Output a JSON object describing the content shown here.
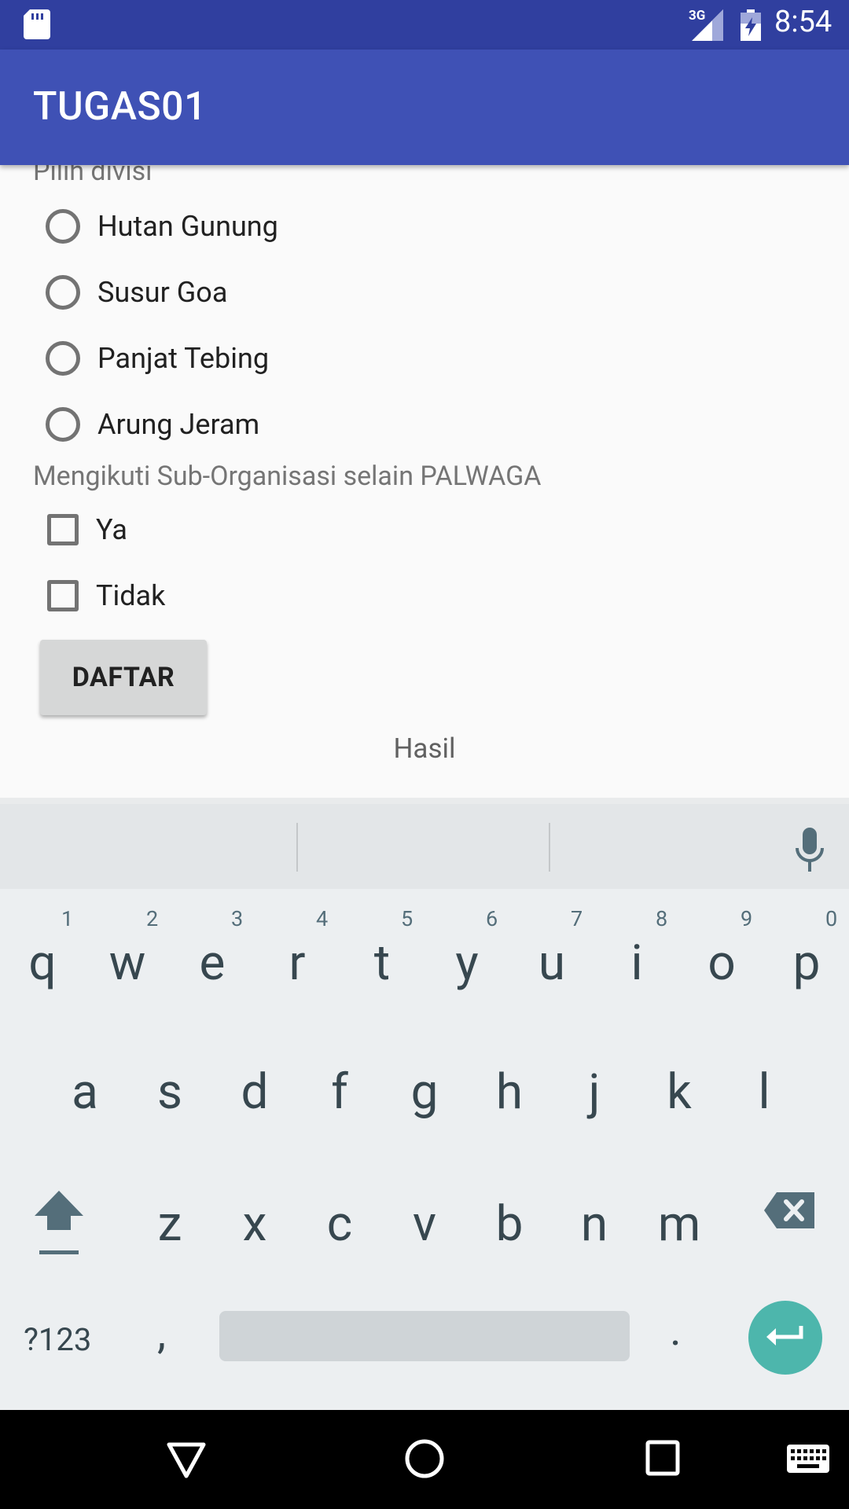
{
  "status_bar": {
    "time": "8:54",
    "network": "3G"
  },
  "app_bar": {
    "title": "TUGAS01"
  },
  "form": {
    "division_label": "Pilih divisi",
    "divisions": [
      "Hutan Gunung",
      "Susur Goa",
      "Panjat Tebing",
      "Arung Jeram"
    ],
    "sub_org_label": "Mengikuti Sub-Organisasi selain PALWAGA",
    "sub_org_options": [
      "Ya",
      "Tidak"
    ],
    "submit_label": "DAFTAR",
    "result_text": "Hasil"
  },
  "keyboard": {
    "row1": [
      "q",
      "w",
      "e",
      "r",
      "t",
      "y",
      "u",
      "i",
      "o",
      "p"
    ],
    "row1_hints": [
      "1",
      "2",
      "3",
      "4",
      "5",
      "6",
      "7",
      "8",
      "9",
      "0"
    ],
    "row2": [
      "a",
      "s",
      "d",
      "f",
      "g",
      "h",
      "j",
      "k",
      "l"
    ],
    "row3": [
      "z",
      "x",
      "c",
      "v",
      "b",
      "n",
      "m"
    ],
    "symbols_label": "?123",
    "comma": ",",
    "period": ".",
    "accent_color": "#4db6ac"
  },
  "colors": {
    "primary": "#3f51b5",
    "primary_dark": "#303f9f"
  }
}
